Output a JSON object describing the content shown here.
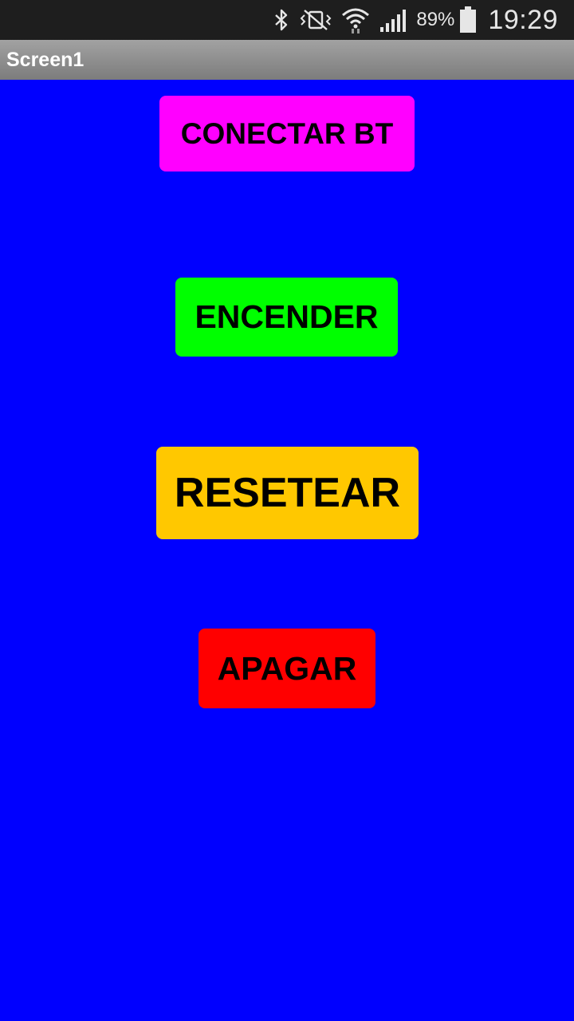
{
  "status_bar": {
    "icons": [
      "bluetooth-icon",
      "vibrate-mute-icon",
      "wifi-icon",
      "cell-signal-icon"
    ],
    "battery_percent": "89%",
    "time": "19:29"
  },
  "title_bar": {
    "title": "Screen1"
  },
  "buttons": {
    "connect": {
      "label": "CONECTAR BT",
      "color": "#ff00ff"
    },
    "on": {
      "label": "ENCENDER",
      "color": "#00ff00"
    },
    "reset": {
      "label": "RESETEAR",
      "color": "#ffc800"
    },
    "off": {
      "label": "APAGAR",
      "color": "#ff0000"
    }
  },
  "colors": {
    "screen_background": "#0000ff"
  }
}
